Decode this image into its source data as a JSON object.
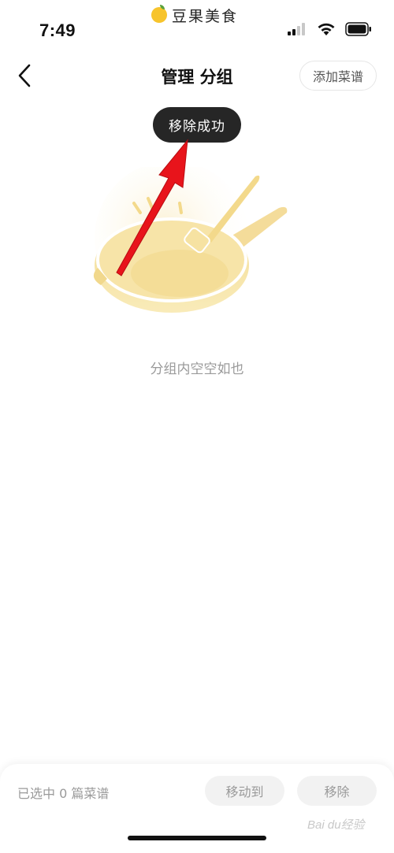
{
  "status_bar": {
    "time": "7:49",
    "app_name": "豆果美食",
    "icons": [
      "signal-icon",
      "wifi-icon",
      "battery-icon"
    ]
  },
  "nav": {
    "back_icon": "chevron-left-icon",
    "title": "管理 分组",
    "add_button": "添加菜谱"
  },
  "toast": {
    "text": "移除成功"
  },
  "empty_state": {
    "icon": "frying-pan-illustration",
    "text": "分组内空空如也"
  },
  "bottom_bar": {
    "selected_text": "已选中 0 篇菜谱",
    "move_button": "移动到",
    "remove_button": "移除"
  },
  "watermark": "Bai du经验",
  "colors": {
    "accent_yellow": "#f7c42c",
    "toast_bg": "#262626",
    "annotation_arrow": "#e8141b",
    "muted_text": "#9a9a9a"
  }
}
